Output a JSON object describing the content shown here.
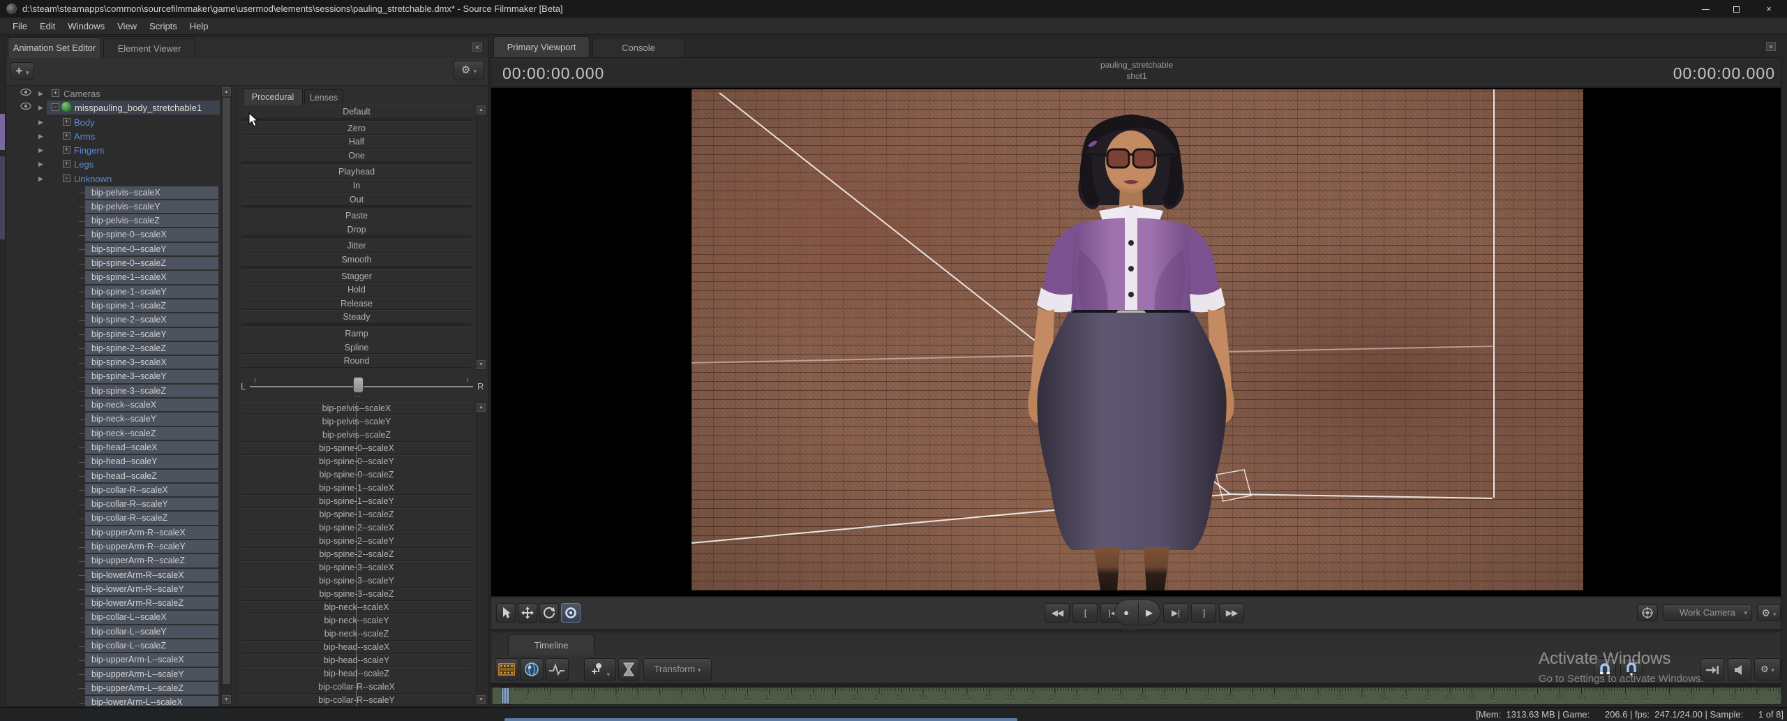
{
  "titlebar": {
    "title": "d:\\steam\\steamapps\\common\\sourcefilmmaker\\game\\usermod\\elements\\sessions\\pauling_stretchable.dmx* - Source Filmmaker [Beta]",
    "close": "×"
  },
  "menubar": [
    "File",
    "Edit",
    "Windows",
    "View",
    "Scripts",
    "Help"
  ],
  "animation_set_editor": {
    "tab_animation_set": "Animation Set Editor",
    "tab_element_viewer": "Element Viewer",
    "add_button": "+",
    "cameras_label": "Cameras",
    "animset_label": "misspauling_body_stretchable1",
    "collapsed_groups": [
      "Body",
      "Arms",
      "Fingers",
      "Legs"
    ],
    "expanded_group": "Unknown",
    "channels": [
      "bip-pelvis--scaleX",
      "bip-pelvis--scaleY",
      "bip-pelvis--scaleZ",
      "bip-spine-0--scaleX",
      "bip-spine-0--scaleY",
      "bip-spine-0--scaleZ",
      "bip-spine-1--scaleX",
      "bip-spine-1--scaleY",
      "bip-spine-1--scaleZ",
      "bip-spine-2--scaleX",
      "bip-spine-2--scaleY",
      "bip-spine-2--scaleZ",
      "bip-spine-3--scaleX",
      "bip-spine-3--scaleY",
      "bip-spine-3--scaleZ",
      "bip-neck--scaleX",
      "bip-neck--scaleY",
      "bip-neck--scaleZ",
      "bip-head--scaleX",
      "bip-head--scaleY",
      "bip-head--scaleZ",
      "bip-collar-R--scaleX",
      "bip-collar-R--scaleY",
      "bip-collar-R--scaleZ",
      "bip-upperArm-R--scaleX",
      "bip-upperArm-R--scaleY",
      "bip-upperArm-R--scaleZ",
      "bip-lowerArm-R--scaleX",
      "bip-lowerArm-R--scaleY",
      "bip-lowerArm-R--scaleZ",
      "bip-collar-L--scaleX",
      "bip-collar-L--scaleY",
      "bip-collar-L--scaleZ",
      "bip-upperArm-L--scaleX",
      "bip-upperArm-L--scaleY",
      "bip-upperArm-L--scaleZ",
      "bip-lowerArm-L--scaleX"
    ]
  },
  "preset_panel": {
    "tab_procedural": "Procedural",
    "tab_lenses": "Lenses",
    "preset_groups": [
      [
        "Default"
      ],
      [
        "Zero",
        "Half",
        "One"
      ],
      [
        "Playhead",
        "In",
        "Out"
      ],
      [
        "Paste",
        "Drop"
      ],
      [
        "Jitter",
        "Smooth"
      ],
      [
        "Stagger",
        "Hold",
        "Release",
        "Steady"
      ],
      [
        "Ramp",
        "Spline",
        "Round"
      ]
    ],
    "slider_left": "L",
    "slider_right": "R",
    "slider_grip": "...",
    "channels": [
      "bip-pelvis--scaleX",
      "bip-pelvis--scaleY",
      "bip-pelvis--scaleZ",
      "bip-spine-0--scaleX",
      "bip-spine-0--scaleY",
      "bip-spine-0--scaleZ",
      "bip-spine-1--scaleX",
      "bip-spine-1--scaleY",
      "bip-spine-1--scaleZ",
      "bip-spine-2--scaleX",
      "bip-spine-2--scaleY",
      "bip-spine-2--scaleZ",
      "bip-spine-3--scaleX",
      "bip-spine-3--scaleY",
      "bip-spine-3--scaleZ",
      "bip-neck--scaleX",
      "bip-neck--scaleY",
      "bip-neck--scaleZ",
      "bip-head--scaleX",
      "bip-head--scaleY",
      "bip-head--scaleZ",
      "bip-collar-R--scaleX",
      "bip-collar-R--scaleY"
    ]
  },
  "viewport": {
    "tab_primary": "Primary Viewport",
    "tab_console": "Console",
    "timecode_left": "00:00:00.000",
    "timecode_right": "00:00:00.000",
    "session_label": "pauling_stretchable",
    "shot_label": "shot1",
    "camera_selector": "Work Camera",
    "playback_grip": "..."
  },
  "timeline": {
    "tab": "Timeline",
    "transform_button": "Transform",
    "ruler_first": 1,
    "ruler_last": 58
  },
  "statusbar": {
    "text": "[Mem:  1313.63 MB | Game:      206.6 | fps:  247.1/24.00 | Sample:      1 of 8]"
  },
  "watermark": {
    "line1": "Activate Windows",
    "line2": "Go to Settings to activate Windows."
  },
  "icons": {
    "dropdown": "▾",
    "rewind": "◀◀",
    "clip_in": "[",
    "prev_frame": "|◀",
    "record": "●",
    "play": "▶",
    "next_frame": "▶|",
    "clip_out": "]",
    "fast_forward": "▶▶",
    "gear": "⚙",
    "scroll_up": "▲",
    "scroll_down": "▼",
    "splitter_dots": "⋮⋮⋮",
    "close_small": "✕"
  },
  "colors": {
    "accent_blue": "#5b8dd6",
    "channel_slate": "#4d535e",
    "ruler_green": "#4d5a45",
    "playhead_blue": "#8ba2c3",
    "shirt_purple": "#9e72ac",
    "filmstrip_orange": "#d9952e"
  }
}
